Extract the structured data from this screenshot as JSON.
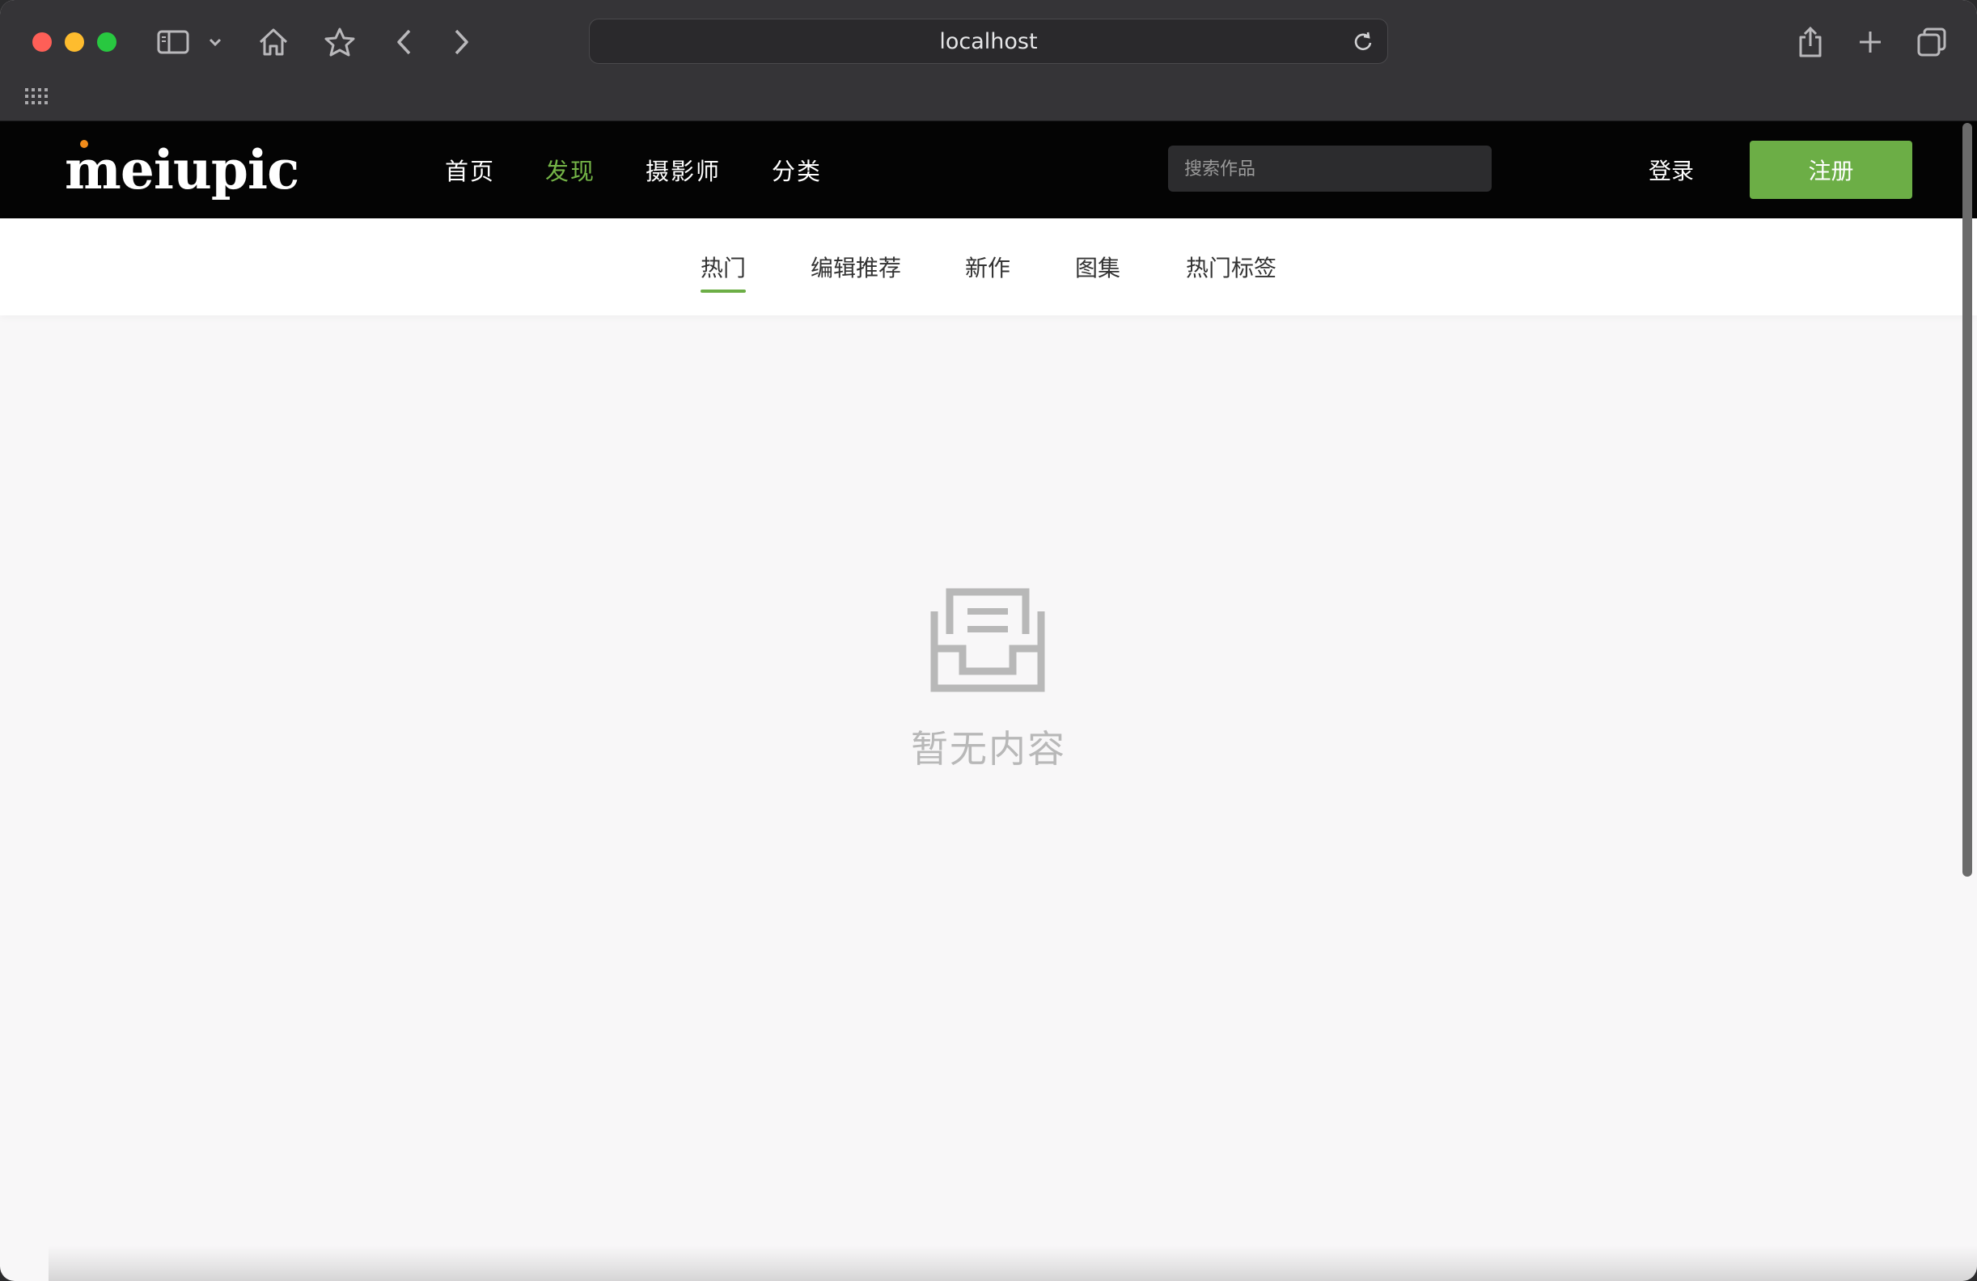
{
  "browser": {
    "url": "localhost",
    "icons": [
      "sidebar-icon",
      "chevron-down-icon",
      "home-icon",
      "star-icon",
      "back-icon",
      "forward-icon",
      "reload-icon",
      "share-icon",
      "new-tab-icon",
      "tabs-overview-icon",
      "bookmarks-grid-icon"
    ]
  },
  "header": {
    "logo": "meiupic",
    "nav": [
      {
        "label": "首页",
        "active": false
      },
      {
        "label": "发现",
        "active": true
      },
      {
        "label": "摄影师",
        "active": false
      },
      {
        "label": "分类",
        "active": false
      }
    ],
    "search_placeholder": "搜索作品",
    "login_label": "登录",
    "register_label": "注册"
  },
  "sub_tabs": [
    {
      "label": "热门",
      "active": true
    },
    {
      "label": "编辑推荐",
      "active": false
    },
    {
      "label": "新作",
      "active": false
    },
    {
      "label": "图集",
      "active": false
    },
    {
      "label": "热门标签",
      "active": false
    }
  ],
  "empty_state": {
    "icon": "inbox-icon",
    "text": "暂无内容"
  },
  "colors": {
    "accent": "#6cae46",
    "header_bg": "#040404",
    "page_bg": "#f8f7f8"
  }
}
